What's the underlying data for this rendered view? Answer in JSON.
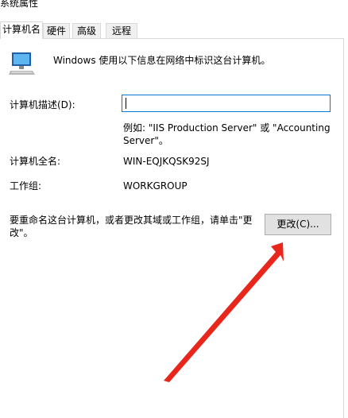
{
  "window": {
    "title": "系统属性"
  },
  "tabs": [
    {
      "label": "计算机名",
      "active": true
    },
    {
      "label": "硬件",
      "active": false
    },
    {
      "label": "高级",
      "active": false
    },
    {
      "label": "远程",
      "active": false
    }
  ],
  "computer_name_panel": {
    "intro": "Windows 使用以下信息在网络中标识这台计算机。",
    "description_label": "计算机描述(D):",
    "description_value": "",
    "example_line1": "例如: \"IIS Production Server\" 或 \"Accounting",
    "example_line2": "Server\"。",
    "full_name_label": "计算机全名:",
    "full_name_value": "WIN-EQJKQSK92SJ",
    "workgroup_label": "工作组:",
    "workgroup_value": "WORKGROUP",
    "rename_text_line1": "要重命名这台计算机，或者更改其域或工作组，请单击\"更",
    "rename_text_line2": "改\"。",
    "change_button_label": "更改(C)..."
  },
  "icons": {
    "computer": "computer-icon"
  },
  "colors": {
    "annotation_arrow": "#e8261c",
    "input_focus_border": "#0078d7",
    "tab_border": "#d9d9d9",
    "button_face": "#e1e1e1"
  }
}
